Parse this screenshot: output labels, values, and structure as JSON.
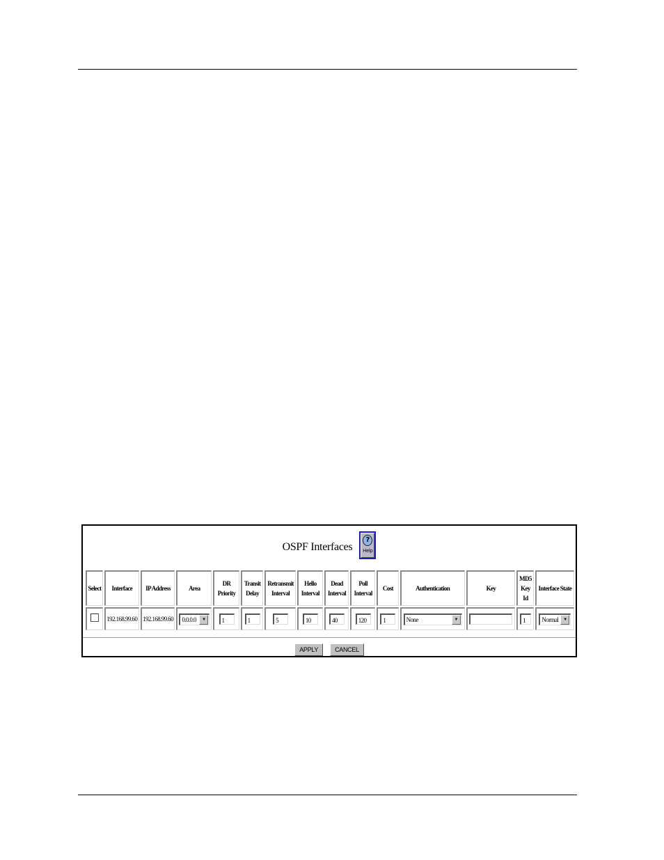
{
  "panel": {
    "title": "OSPF Interfaces",
    "help_label": "Help",
    "help_icon": "question-mark-help-icon"
  },
  "table": {
    "headers": {
      "select": "Select",
      "interface": "Interface",
      "ip_address": "IP Address",
      "area": "Area",
      "dr_priority": [
        "DR",
        "Priority"
      ],
      "transit_delay": [
        "Transit",
        "Delay"
      ],
      "retransmit_interval": [
        "Retransmit",
        "Interval"
      ],
      "hello_interval": [
        "Hello",
        "Interval"
      ],
      "dead_interval": [
        "Dead",
        "Interval"
      ],
      "poll_interval": [
        "Poll",
        "Interval"
      ],
      "cost": "Cost",
      "authentication": "Authentication",
      "key": "Key",
      "md5_key_id": [
        "MD5",
        "Key",
        "Id"
      ],
      "interface_state": "Interface State"
    },
    "rows": [
      {
        "selected": false,
        "interface": "192.168.99.60",
        "ip_address": "192.168.99.60",
        "area": "0.0.0.0",
        "dr_priority": "1",
        "transit_delay": "1",
        "retransmit_interval": "5",
        "hello_interval": "10",
        "dead_interval": "40",
        "poll_interval": "120",
        "cost": "1",
        "authentication": "None",
        "key": "",
        "md5_key_id": "1",
        "interface_state": "Normal"
      }
    ]
  },
  "buttons": {
    "apply": "APPLY",
    "cancel": "CANCEL"
  },
  "icons": {
    "dropdown_arrow": "▼"
  }
}
